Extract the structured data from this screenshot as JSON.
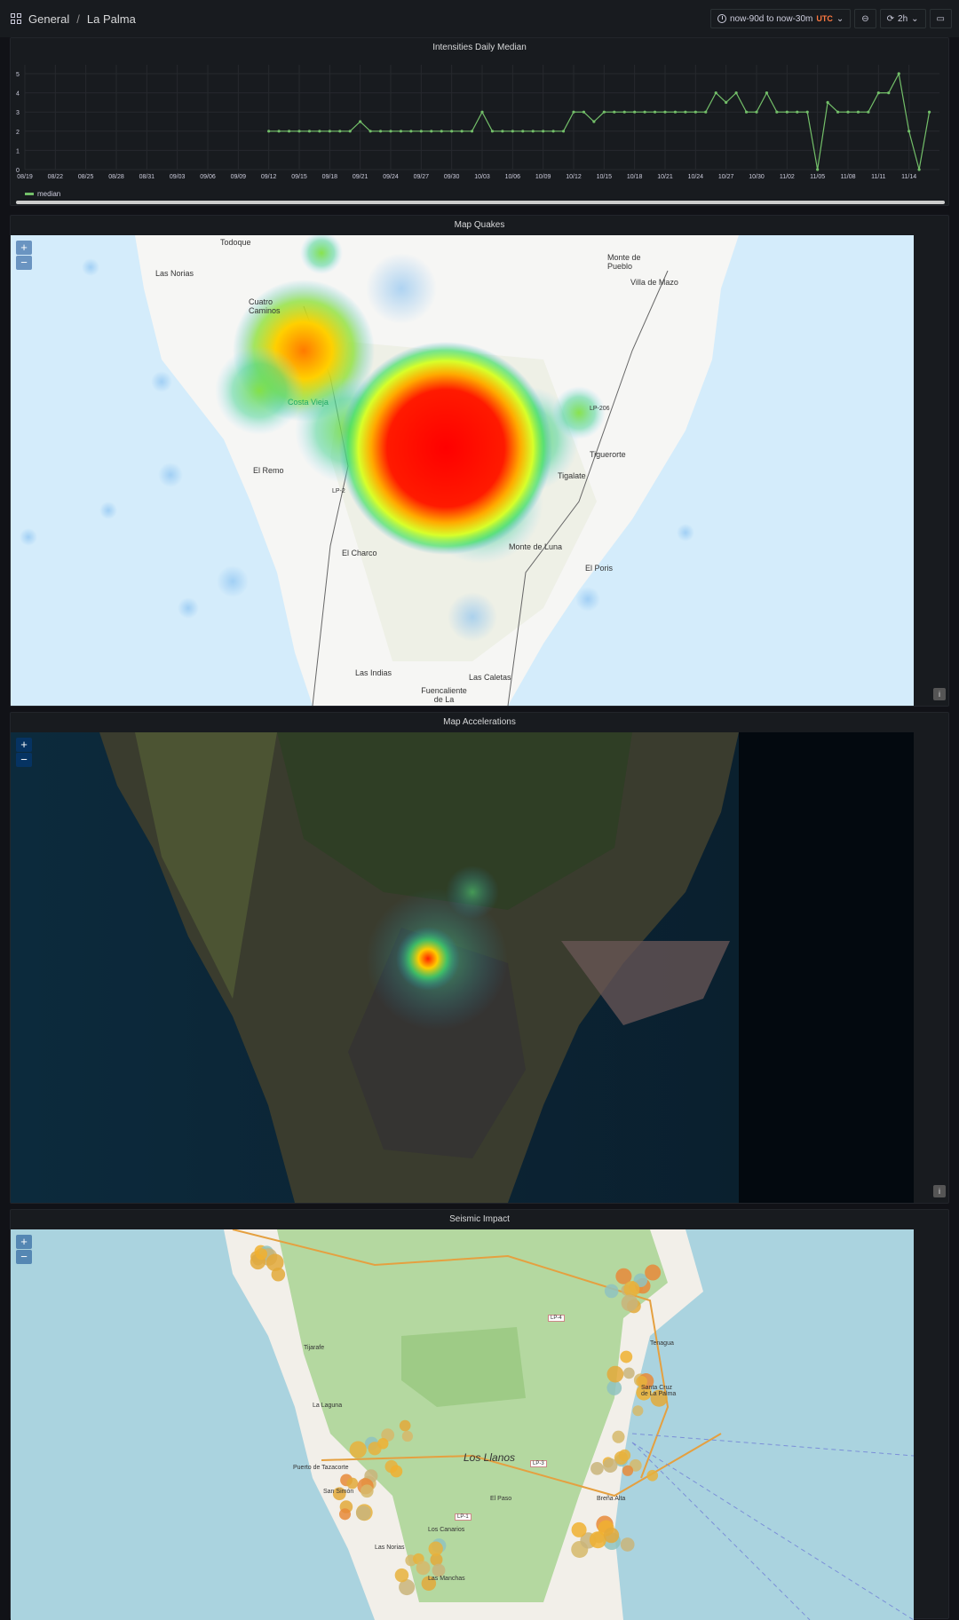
{
  "header": {
    "folder": "General",
    "separator": "/",
    "dashboard": "La Palma",
    "time_range": "now-90d to now-30m",
    "timezone": "UTC",
    "refresh": "2h"
  },
  "panels": {
    "intensities": {
      "title": "Intensities Daily Median",
      "legend": "median"
    },
    "quakes": {
      "title": "Map Quakes"
    },
    "accelerations": {
      "title": "Map Accelerations"
    },
    "impact": {
      "title": "Seismic Impact"
    }
  },
  "zoom": {
    "plus": "+",
    "minus": "−",
    "info": "i"
  },
  "map_labels": {
    "quakes": [
      "Todoque",
      "Las Norias",
      "Cuatro Caminos",
      "Costa Vieja",
      "El Remo",
      "El Charco",
      "Las Indias",
      "Fuencaliente de La",
      "Las Caletas",
      "Monte de Pueblo",
      "Villa de Mazo",
      "Tigalate",
      "Tiguerorte",
      "Monte de Luna",
      "El Poris",
      "LP-2",
      "LP-206"
    ],
    "impact": [
      "Tijarafe",
      "Puerto de Tazacorte",
      "San Simón",
      "Los Llanos",
      "Las Norias",
      "La Laguna",
      "Santa Cruz de La Palma",
      "El Paso",
      "Los Canarios",
      "Las Manchas",
      "LP-4",
      "LP-3",
      "LP-1",
      "Tenagua",
      "Breña Alta"
    ]
  },
  "chart_data": {
    "type": "line",
    "title": "Intensities Daily Median",
    "series": [
      {
        "name": "median",
        "color": "#73bf69",
        "x": [
          "09/12",
          "09/13",
          "09/14",
          "09/15",
          "09/16",
          "09/17",
          "09/18",
          "09/19",
          "09/20",
          "09/21",
          "09/22",
          "09/23",
          "09/24",
          "09/25",
          "09/26",
          "09/27",
          "09/28",
          "09/29",
          "09/30",
          "10/01",
          "10/02",
          "10/03",
          "10/04",
          "10/05",
          "10/06",
          "10/07",
          "10/08",
          "10/09",
          "10/10",
          "10/11",
          "10/12",
          "10/13",
          "10/14",
          "10/15",
          "10/16",
          "10/17",
          "10/18",
          "10/19",
          "10/20",
          "10/21",
          "10/22",
          "10/23",
          "10/24",
          "10/25",
          "10/26",
          "10/27",
          "10/28",
          "10/29",
          "10/30",
          "10/31",
          "11/01",
          "11/02",
          "11/03",
          "11/04",
          "11/05",
          "11/06",
          "11/07",
          "11/08",
          "11/09",
          "11/10",
          "11/11",
          "11/12",
          "11/13",
          "11/14",
          "11/15",
          "11/16"
        ],
        "values": [
          2,
          2,
          2,
          2,
          2,
          2,
          2,
          2,
          2,
          2.5,
          2,
          2,
          2,
          2,
          2,
          2,
          2,
          2,
          2,
          2,
          2,
          3,
          2,
          2,
          2,
          2,
          2,
          2,
          2,
          2,
          3,
          3,
          2.5,
          3,
          3,
          3,
          3,
          3,
          3,
          3,
          3,
          3,
          3,
          3,
          4,
          3.5,
          4,
          3,
          3,
          4,
          3,
          3,
          3,
          3,
          0,
          3.5,
          3,
          3,
          3,
          3,
          4,
          4,
          5,
          2,
          0,
          3
        ]
      }
    ],
    "x_ticks": [
      "08/19",
      "08/22",
      "08/25",
      "08/28",
      "08/31",
      "09/03",
      "09/06",
      "09/09",
      "09/12",
      "09/15",
      "09/18",
      "09/21",
      "09/24",
      "09/27",
      "09/30",
      "10/03",
      "10/06",
      "10/09",
      "10/12",
      "10/15",
      "10/18",
      "10/21",
      "10/24",
      "10/27",
      "10/30",
      "11/02",
      "11/05",
      "11/08",
      "11/11",
      "11/14"
    ],
    "y_ticks": [
      0,
      1,
      2,
      3,
      4,
      5
    ],
    "ylim": [
      0,
      5
    ],
    "x_start": "08/19",
    "days_total": 90,
    "grid": true,
    "legend": "bottom-left"
  }
}
